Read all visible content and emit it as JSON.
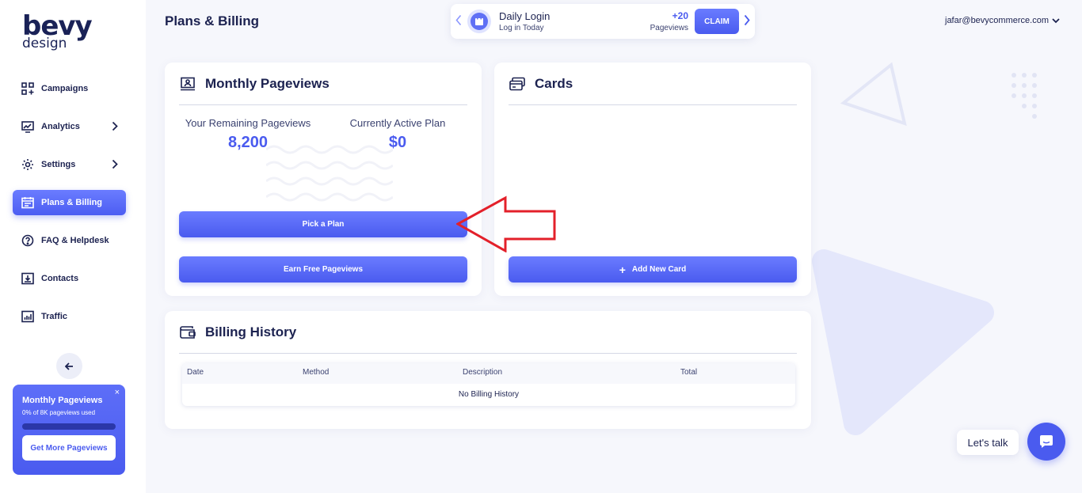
{
  "brand": {
    "name": "bevy",
    "sub": "design"
  },
  "sidebar": {
    "items": [
      {
        "label": "Campaigns",
        "icon": "campaigns-icon"
      },
      {
        "label": "Analytics",
        "icon": "analytics-icon"
      },
      {
        "label": "Settings",
        "icon": "gear-icon"
      },
      {
        "label": "Plans & Billing",
        "icon": "calendar-icon"
      },
      {
        "label": "FAQ & Helpdesk",
        "icon": "help-icon"
      },
      {
        "label": "Contacts",
        "icon": "contacts-icon"
      },
      {
        "label": "Traffic",
        "icon": "traffic-icon"
      }
    ],
    "promo": {
      "title": "Monthly Pageviews",
      "subtitle": "0% of 8K pageviews used",
      "usage_fraction": 0,
      "button": "Get More Pageviews",
      "close": "×"
    }
  },
  "header": {
    "title": "Plans & Billing",
    "daily_login": {
      "title": "Daily Login",
      "subtitle": "Log in Today",
      "points": "+20",
      "points_label": "Pageviews",
      "claim": "CLAIM"
    },
    "user_email": "jafar@bevycommerce.com"
  },
  "monthly_pageviews": {
    "title": "Monthly Pageviews",
    "remaining_label": "Your Remaining Pageviews",
    "remaining_value": "8,200",
    "plan_label": "Currently Active Plan",
    "plan_value": "$0",
    "pick_plan": "Pick a Plan",
    "earn_free": "Earn Free Pageviews"
  },
  "cards": {
    "title": "Cards",
    "add_card": "Add New Card",
    "add_icon": "+"
  },
  "billing_history": {
    "title": "Billing History",
    "columns": [
      "Date",
      "Method",
      "Description",
      "Total"
    ],
    "empty": "No Billing History"
  },
  "chat": {
    "label": "Let's talk"
  },
  "colors": {
    "accent": "#4a5bef",
    "navy": "#1c2250",
    "annotation": "#e3202a"
  }
}
